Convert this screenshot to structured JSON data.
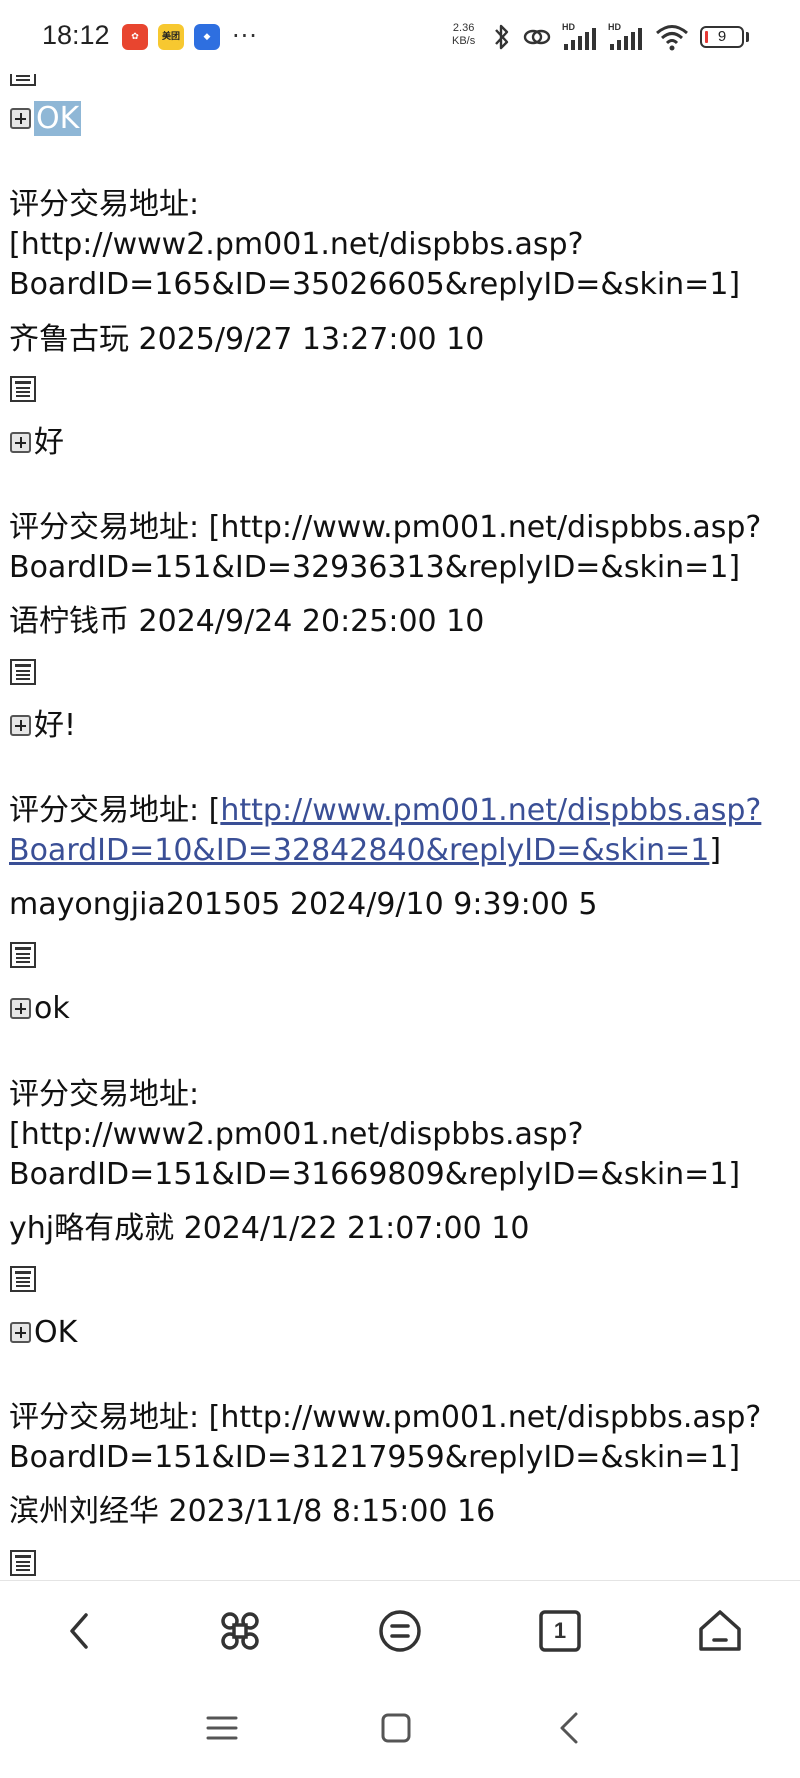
{
  "status_bar": {
    "time": "18:12",
    "apps": [
      {
        "label": "",
        "icon": "red-app-icon"
      },
      {
        "label": "美团",
        "icon": "meituan-icon"
      },
      {
        "label": "",
        "icon": "blue-app-icon"
      }
    ],
    "more": "···",
    "net_speed_value": "2.36",
    "net_speed_unit": "KB/s",
    "battery": "9",
    "battery_fraction": 0.09
  },
  "content": {
    "top_reply": "OK",
    "posts": [
      {
        "prefix": "评分交易地址: ",
        "link_text": "http://www2.pm001.net/dispbbs.asp?BoardID=165&ID=35026605&replyID=&skin=1",
        "line1": "评分交易地址:",
        "line2": "[http://www2.pm001.net/dispbbs.asp?",
        "line3": "BoardID=165&ID=35026605&replyID=&skin=1]",
        "user_line": "齐鲁古玩 2025/9/27 13:27:00 10",
        "reply": "好"
      },
      {
        "line1": "评分交易地址: [http://www.pm001.net/dispbbs.asp?",
        "line2": "BoardID=151&ID=32936313&replyID=&skin=1]",
        "user_line": "语柠钱币 2024/9/24 20:25:00 10",
        "reply": "好!"
      },
      {
        "line1_prefix": "评分交易地址: [",
        "line1_link": "http://www.pm001.net/dispbbs.asp?",
        "line2_link": "BoardID=10&ID=32842840&replyID=&skin=1",
        "line2_suffix": "]",
        "user_line": "mayongjia201505 2024/9/10 9:39:00 5",
        "reply": "ok"
      },
      {
        "line1": "评分交易地址:",
        "line2": "[http://www2.pm001.net/dispbbs.asp?",
        "line3": "BoardID=151&ID=31669809&replyID=&skin=1]",
        "user_line": "yhj略有成就 2024/1/22 21:07:00 10",
        "reply": "OK"
      },
      {
        "line1": "评分交易地址: [http://www.pm001.net/dispbbs.asp?",
        "line2": "BoardID=151&ID=31217959&replyID=&skin=1]",
        "user_line": "滨州刘经华 2023/11/8 8:15:00 16"
      }
    ]
  },
  "toolbar": {
    "buttons": [
      "back-icon",
      "command-icon",
      "menu-icon",
      "tabs-icon",
      "home-icon"
    ],
    "tab_count": "1"
  },
  "system_nav": {
    "buttons": [
      "recents-icon",
      "home-square-icon",
      "back-chevron-icon"
    ]
  },
  "colors": {
    "link": "#3a4f96",
    "highlight": "#8fb7d6",
    "battery_low": "#e53935"
  }
}
